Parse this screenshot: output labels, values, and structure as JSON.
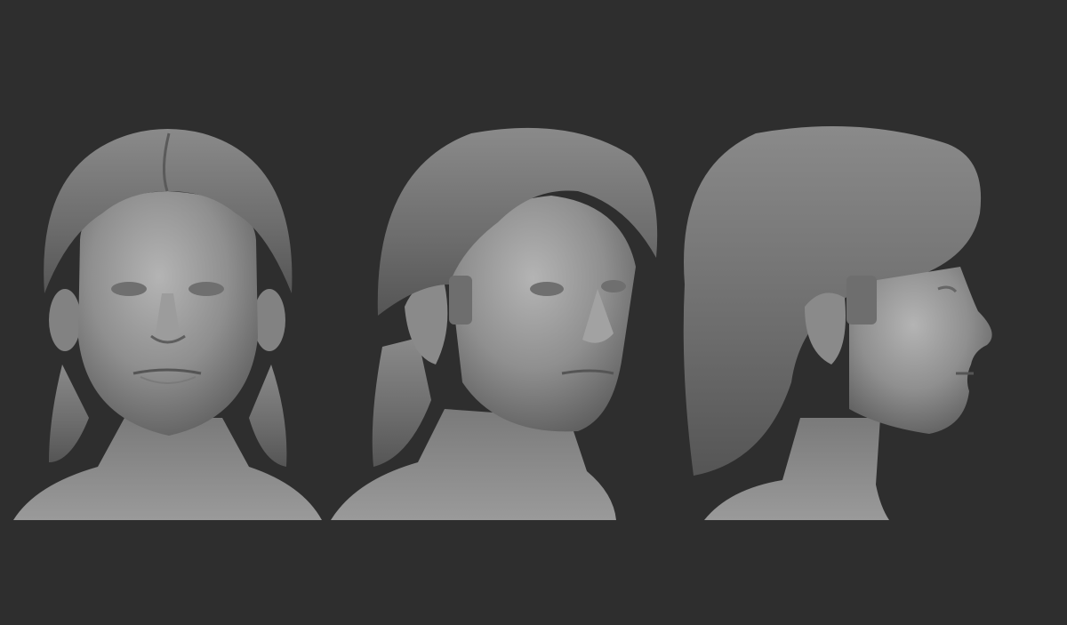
{
  "scene": {
    "background_color": "#2e2e2e",
    "clay_color": "#8e8e8e",
    "views": [
      {
        "id": "front",
        "view": "front"
      },
      {
        "id": "three-quarter",
        "view": "three-quarter"
      },
      {
        "id": "side",
        "view": "profile-right"
      }
    ]
  }
}
